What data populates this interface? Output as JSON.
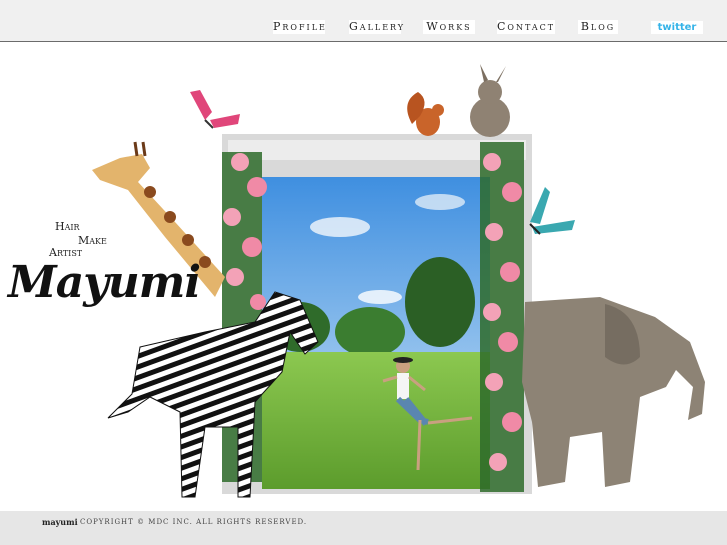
{
  "nav": {
    "items": [
      "Profile",
      "Gallery",
      "Works",
      "Contact",
      "Blog"
    ],
    "twitter_label": "twitter"
  },
  "logo": {
    "line1": "Hair",
    "line2": "Make",
    "line3": "Artist",
    "name": "Mayumi"
  },
  "footer": {
    "brand": "mayumi",
    "copyright": "COPYRIGHT © MDC INC. ALL RIGHTS RESERVED."
  },
  "colors": {
    "topbar_bg": "#f0f0f0",
    "twitter_blue": "#35b3e8",
    "footer_bg": "#e6e6e6"
  }
}
